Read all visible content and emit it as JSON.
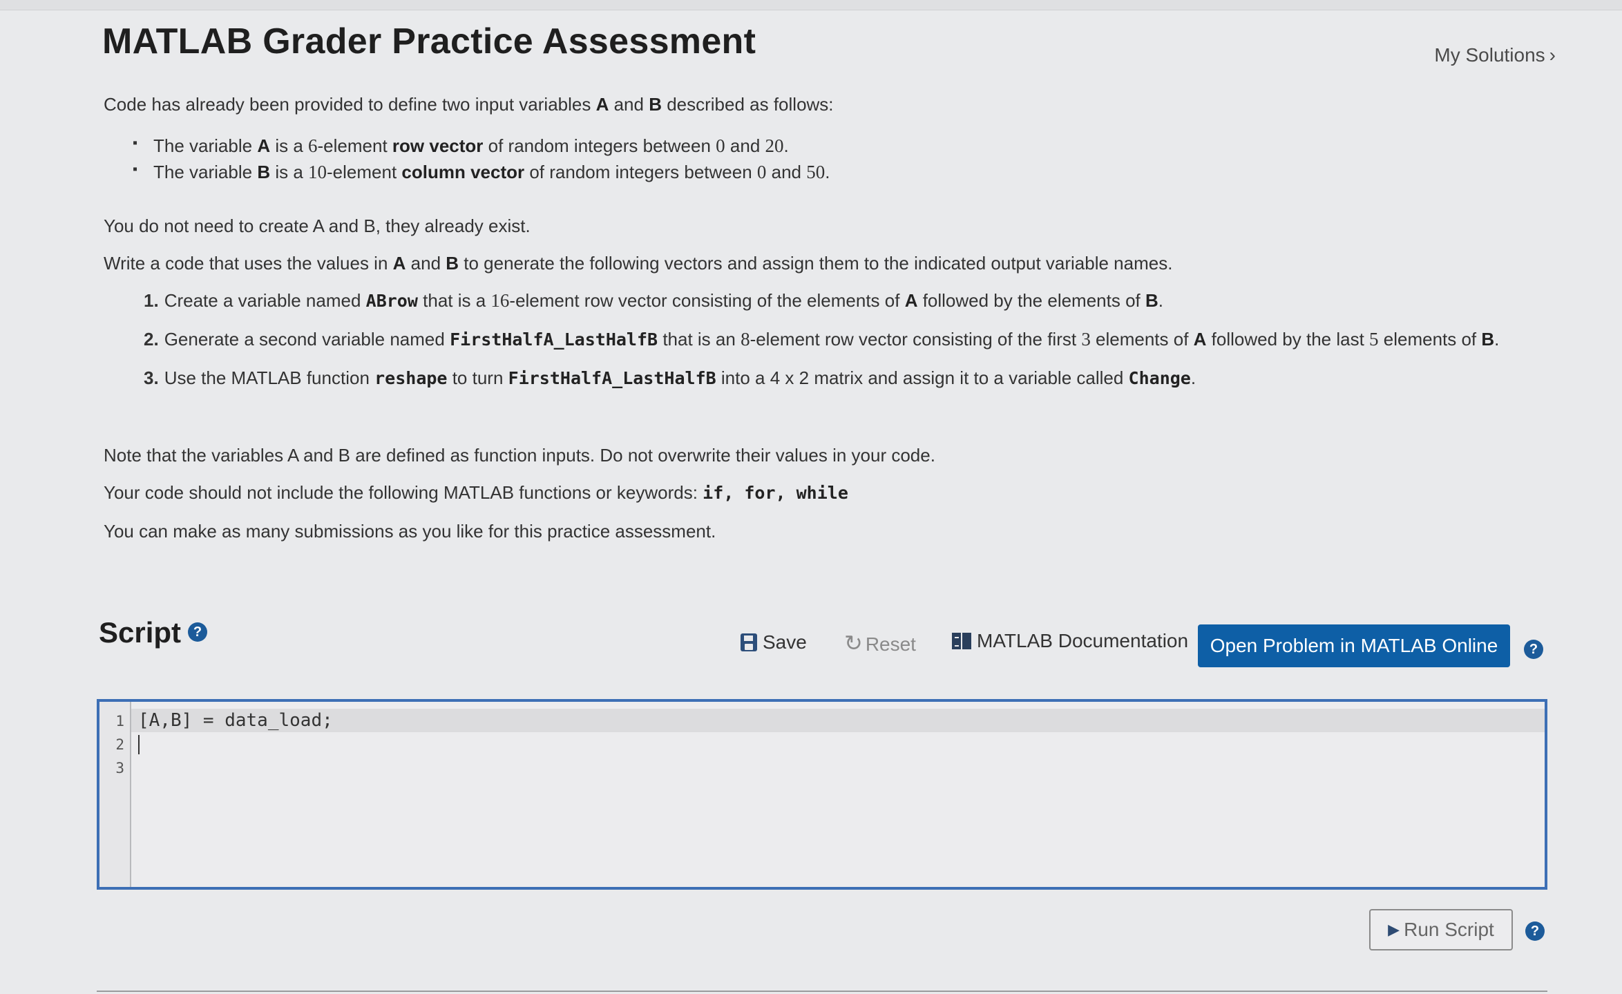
{
  "header": {
    "title": "MATLAB Grader Practice Assessment",
    "my_solutions": "My Solutions",
    "chevron": "›"
  },
  "problem": {
    "intro": {
      "t1": "Code has already been provided to define two input variables ",
      "a": "A",
      "t2": " and ",
      "b": "B",
      "t3": " described as follows:"
    },
    "bullets": [
      {
        "t1": "The variable ",
        "var": "A",
        "t2": " is a ",
        "n": "6",
        "t3": "-element ",
        "kind": "row vector",
        "t4": " of random integers between ",
        "lo": "0",
        "and": " and ",
        "hi": "20",
        "end": "."
      },
      {
        "t1": "The variable ",
        "var": "B",
        "t2": " is a ",
        "n": "10",
        "t3": "-element ",
        "kind": "column vector",
        "t4": " of random integers between ",
        "lo": "0",
        "and": " and ",
        "hi": "50",
        "end": "."
      }
    ],
    "no_need": "You do not need to create A and B, they already exist.",
    "write": {
      "t1": "Write a code that uses the values in ",
      "a": "A",
      "t2": " and ",
      "b": "B",
      "t3": " to generate the following  vectors and assign them to the indicated output variable names."
    },
    "step1": {
      "num": "1.",
      "t1": "Create a variable named ",
      "code": "ABrow",
      "t2": " that is a ",
      "n": "16",
      "t3": "-element row vector consisting of the elements of ",
      "a": "A",
      "t4": " followed by the elements of ",
      "b": "B",
      "end": "."
    },
    "step2": {
      "num": "2.",
      "t1": "Generate a second variable named ",
      "code": "FirstHalfA_LastHalfB",
      "t2": " that is an ",
      "n1": "8",
      "t3": "-element row vector consisting of the first ",
      "n2": "3",
      "t4": " elements of ",
      "a": "A",
      "t5": " followed by the last ",
      "n3": "5",
      "t6": " elements of ",
      "b": "B",
      "end": "."
    },
    "step3": {
      "num": "3.",
      "t1": "Use the MATLAB function  ",
      "fn": "reshape",
      "t2": " to turn ",
      "code": "FirstHalfA_LastHalfB",
      "t3": " into a 4 x 2 matrix and assign it to a variable called ",
      "out": "Change",
      "end": "."
    },
    "note": "Note that the variables A and B are defined as function inputs.  Do not overwrite their values in your code.",
    "forbid": {
      "t1": "Your code should not include the following MATLAB functions or keywords: ",
      "kw": "if, for, while"
    },
    "submissions": "You can make as many submissions as you like for this practice assessment."
  },
  "script": {
    "heading": "Script",
    "help": "?",
    "save": "Save",
    "reset_glyph": "↻",
    "reset": "Reset",
    "docs": "MATLAB Documentation",
    "open_online": "Open Problem in MATLAB Online",
    "lines": [
      "1",
      "2",
      "3"
    ],
    "code_line_1": "[A,B] = data_load;",
    "run": "Run Script",
    "run_glyph": "▶"
  },
  "icons": [
    "save-icon",
    "reset-icon",
    "book-icon",
    "help-icon",
    "play-icon",
    "chevron-right-icon"
  ],
  "colors": {
    "primary_button": "#0e5fa6",
    "help_icon": "#1c5b9a",
    "editor_border": "#3d6fb5"
  }
}
